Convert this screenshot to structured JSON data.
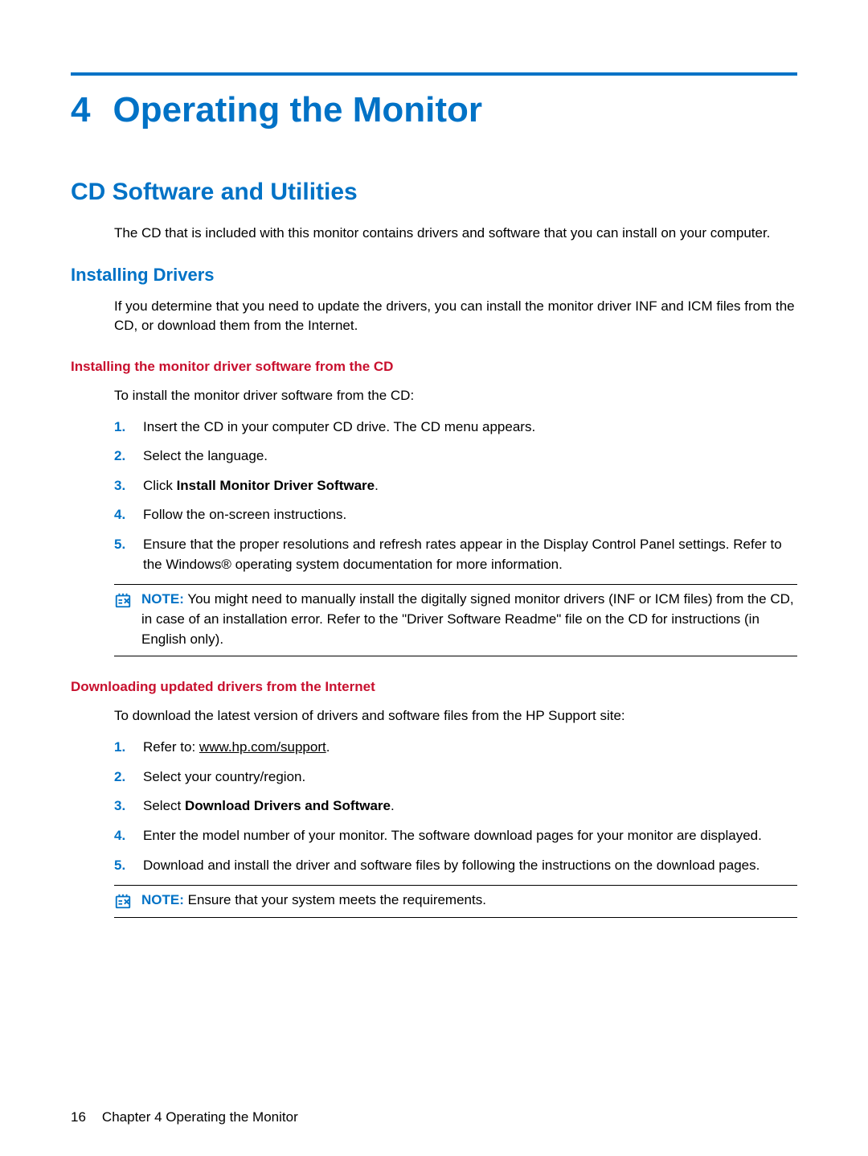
{
  "chapter": {
    "number": "4",
    "title": "Operating the Monitor"
  },
  "section1": {
    "title": "CD Software and Utilities",
    "intro": "The CD that is included with this monitor contains drivers and software that you can install on your computer."
  },
  "sub1": {
    "title": "Installing Drivers",
    "intro": "If you determine that you need to update the drivers, you can install the monitor driver INF and ICM files from the CD, or download them from the Internet."
  },
  "sub1a": {
    "title": "Installing the monitor driver software from the CD",
    "lead": "To install the monitor driver software from the CD:",
    "steps": {
      "s1": "Insert the CD in your computer CD drive. The CD menu appears.",
      "s2": "Select the language.",
      "s3_pre": "Click ",
      "s3_bold": "Install Monitor Driver Software",
      "s3_post": ".",
      "s4": "Follow the on-screen instructions.",
      "s5": "Ensure that the proper resolutions and refresh rates appear in the Display Control Panel settings. Refer to the Windows® operating system documentation for more information."
    },
    "note_label": "NOTE:",
    "note_text": "You might need to manually install the digitally signed monitor drivers (INF or ICM files) from the CD, in case of an installation error. Refer to the \"Driver Software Readme\" file on the CD for instructions (in English only)."
  },
  "sub1b": {
    "title": "Downloading updated drivers from the Internet",
    "lead": "To download the latest version of drivers and software files from the HP Support site:",
    "steps": {
      "s1_pre": "Refer to: ",
      "s1_link": "www.hp.com/support",
      "s1_post": ".",
      "s2": "Select your country/region.",
      "s3_pre": "Select ",
      "s3_bold": "Download Drivers and Software",
      "s3_post": ".",
      "s4": "Enter the model number of your monitor. The software download pages for your monitor are displayed.",
      "s5": "Download and install the driver and software files by following the instructions on the download pages."
    },
    "note_label": "NOTE:",
    "note_text": "Ensure that your system meets the requirements."
  },
  "footer": {
    "page_number": "16",
    "chapter_label": "Chapter 4   Operating the Monitor"
  }
}
